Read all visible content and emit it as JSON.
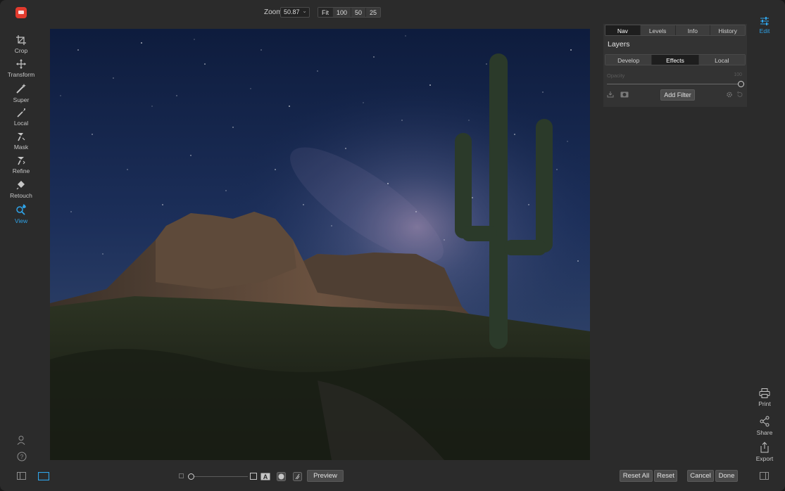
{
  "toolbar": {
    "zoom_label": "Zoom",
    "zoom_value": "50.87",
    "zoom_presets": [
      "Fit",
      "100",
      "50",
      "25"
    ]
  },
  "left_tools": [
    {
      "label": "Crop",
      "icon": "crop-icon"
    },
    {
      "label": "Transform",
      "icon": "move-icon"
    },
    {
      "label": "Super",
      "icon": "magic-wand-icon"
    },
    {
      "label": "Local",
      "icon": "brush-icon"
    },
    {
      "label": "Mask",
      "icon": "mask-brush-icon"
    },
    {
      "label": "Refine",
      "icon": "refine-brush-icon"
    },
    {
      "label": "Retouch",
      "icon": "retouch-icon"
    },
    {
      "label": "View",
      "icon": "view-zoom-icon",
      "active": true
    }
  ],
  "panel": {
    "tabs": [
      "Nav",
      "Levels",
      "Info",
      "History"
    ],
    "selected_tab": "Nav",
    "title": "Layers",
    "subtabs": [
      "Develop",
      "Effects",
      "Local"
    ],
    "selected_subtab": "Effects",
    "opacity_label": "Opacity",
    "opacity_value": "100",
    "add_filter": "Add Filter"
  },
  "right_tools": {
    "edit": "Edit",
    "print": "Print",
    "share": "Share",
    "export": "Export"
  },
  "bottom": {
    "preview": "Preview",
    "reset_all": "Reset All",
    "reset": "Reset",
    "cancel": "Cancel",
    "done": "Done"
  },
  "colors": {
    "accent": "#2fa3e8",
    "background": "#2b2b2b",
    "panel": "#333333"
  }
}
